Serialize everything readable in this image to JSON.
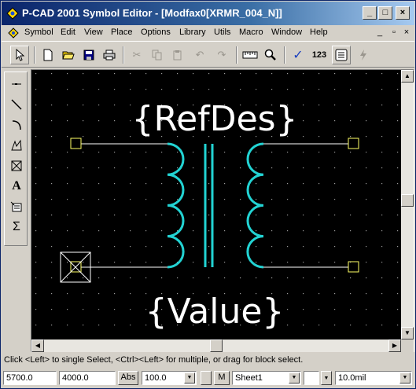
{
  "window": {
    "title": "P-CAD 2001 Symbol Editor - [Modfax0[XRMR_004_N]]",
    "minimize": "_",
    "maximize": "□",
    "close": "×"
  },
  "menu": {
    "items": [
      "Symbol",
      "Edit",
      "View",
      "Place",
      "Options",
      "Library",
      "Utils",
      "Macro",
      "Window",
      "Help"
    ],
    "mdi_minimize": "_",
    "mdi_restore": "▫",
    "mdi_close": "×"
  },
  "toolbar": {
    "numbers_label": "123"
  },
  "canvas": {
    "refdes_text": "{RefDes}",
    "value_text": "{Value}",
    "pin_color": "#ffff66",
    "coil_color": "#22d3d3",
    "text_color": "#ffffff"
  },
  "status_message": "Click <Left> to single Select, <Ctrl><Left> for multiple, or drag for block select.",
  "bottom": {
    "x_coord": "5700.0",
    "y_coord": "4000.0",
    "abs_label": "Abs",
    "zoom": "100.0",
    "m_label": "M",
    "sheet": "Sheet1",
    "line_width": "10.0mil"
  }
}
